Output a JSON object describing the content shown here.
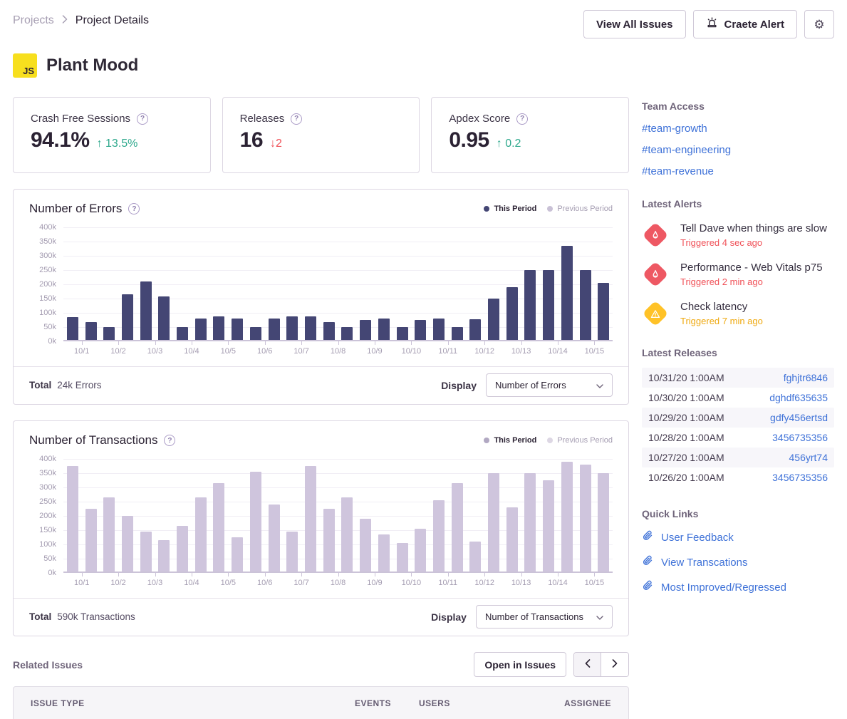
{
  "breadcrumb": {
    "items": [
      "Projects",
      "Project Details"
    ]
  },
  "header": {
    "view_all_issues": "View All Issues",
    "create_alert": "Craete Alert"
  },
  "project": {
    "badge": "JS",
    "name": "Plant Mood"
  },
  "icons": {
    "help": "?",
    "settings": "⚙"
  },
  "colors": {
    "accent_blue": "#3f72d8",
    "positive_green": "#2fa98d",
    "negative_red": "#f05158",
    "critical_icon_red": "#ee5863",
    "warning_icon_yellow": "#ffc227",
    "warning_text_yellow": "#efa910",
    "bar_dark": "#444674",
    "bar_light": "#cfc5dd"
  },
  "stats": [
    {
      "label": "Crash Free Sessions",
      "value": "94.1%",
      "delta_arrow": "↑",
      "delta": "13.5%",
      "delta_color": "#2fa98d"
    },
    {
      "label": "Releases",
      "value": "16",
      "delta_arrow": "↓",
      "delta": "2",
      "delta_color": "#f05158"
    },
    {
      "label": "Apdex Score",
      "value": "0.95",
      "delta_arrow": "↑",
      "delta": "0.2",
      "delta_color": "#2fa98d"
    }
  ],
  "chart_data": [
    {
      "type": "bar",
      "title": "Number of Errors",
      "legend": [
        {
          "label": "This Period",
          "dot_color": "#444674"
        },
        {
          "label": "Previous Period",
          "dot_color": "#c9c1d6"
        }
      ],
      "bar_color": "#444674",
      "categories": [
        "10/1",
        "10/2",
        "10/3",
        "10/4",
        "10/5",
        "10/6",
        "10/7",
        "10/8",
        "10/9",
        "10/10",
        "10/11",
        "10/12",
        "10/13",
        "10/14",
        "10/15"
      ],
      "values_thousands": [
        [
          80,
          62
        ],
        [
          45,
          160
        ],
        [
          205,
          152
        ],
        [
          45,
          75
        ],
        [
          82,
          75
        ],
        [
          45,
          75
        ],
        [
          82,
          82
        ],
        [
          62,
          45
        ],
        [
          70,
          75
        ],
        [
          45,
          70
        ],
        [
          75,
          45
        ],
        [
          72,
          145
        ],
        [
          185,
          245
        ],
        [
          245,
          330
        ],
        [
          245,
          200
        ]
      ],
      "y_ticks": [
        "400k",
        "350k",
        "300k",
        "250k",
        "200k",
        "150k",
        "100k",
        "50k",
        "0k"
      ],
      "ylim_thousands": [
        0,
        400
      ],
      "ylabel": "",
      "xlabel": "",
      "grid": true,
      "legend_position": "top-right",
      "footer": {
        "total_label": "Total",
        "total_value": "24k Errors",
        "display_label": "Display",
        "display_value": "Number of Errors"
      }
    },
    {
      "type": "bar",
      "title": "Number of Transactions",
      "legend": [
        {
          "label": "This Period",
          "dot_color": "#b1a8c2"
        },
        {
          "label": "Previous Period",
          "dot_color": "#ddd7e4"
        }
      ],
      "bar_color": "#cfc5dd",
      "categories": [
        "10/1",
        "10/2",
        "10/3",
        "10/4",
        "10/5",
        "10/6",
        "10/7",
        "10/8",
        "10/9",
        "10/10",
        "10/11",
        "10/12",
        "10/13",
        "10/14",
        "10/15"
      ],
      "values_thousands": [
        [
          370,
          220
        ],
        [
          260,
          195
        ],
        [
          140,
          110
        ],
        [
          160,
          260
        ],
        [
          310,
          120
        ],
        [
          350,
          235
        ],
        [
          140,
          370
        ],
        [
          220,
          260
        ],
        [
          185,
          130
        ],
        [
          100,
          150
        ],
        [
          250,
          310
        ],
        [
          105,
          345
        ],
        [
          225,
          345
        ],
        [
          320,
          385
        ],
        [
          375,
          345
        ]
      ],
      "y_ticks": [
        "400k",
        "350k",
        "300k",
        "250k",
        "200k",
        "150k",
        "100k",
        "50k",
        "0k"
      ],
      "ylim_thousands": [
        0,
        400
      ],
      "ylabel": "",
      "xlabel": "",
      "grid": true,
      "legend_position": "top-right",
      "footer": {
        "total_label": "Total",
        "total_value": "590k Transactions",
        "display_label": "Display",
        "display_value": "Number of Transactions"
      }
    }
  ],
  "related_issues": {
    "title": "Related Issues",
    "open_button": "Open in Issues",
    "columns": [
      "ISSUE TYPE",
      "EVENTS",
      "USERS",
      "ASSIGNEE"
    ]
  },
  "sidebar": {
    "team_access": {
      "title": "Team Access",
      "links": [
        "#team-growth",
        "#team-engineering",
        "#team-revenue"
      ]
    },
    "latest_alerts": {
      "title": "Latest Alerts",
      "alerts": [
        {
          "title": "Tell Dave when things are slow",
          "status": "Triggered 4 sec ago",
          "severity": "critical"
        },
        {
          "title": "Performance - Web Vitals p75",
          "status": "Triggered 2 min ago",
          "severity": "critical"
        },
        {
          "title": "Check latency",
          "status": "Triggered 7 min ago",
          "severity": "warning"
        }
      ]
    },
    "latest_releases": {
      "title": "Latest Releases",
      "rows": [
        {
          "date": "10/31/20 1:00AM",
          "version": "fghjtr6846"
        },
        {
          "date": "10/30/20 1:00AM",
          "version": "dghdf635635"
        },
        {
          "date": "10/29/20 1:00AM",
          "version": "gdfy456ertsd"
        },
        {
          "date": "10/28/20 1:00AM",
          "version": "3456735356"
        },
        {
          "date": "10/27/20 1:00AM",
          "version": "456yrt74"
        },
        {
          "date": "10/26/20 1:00AM",
          "version": "3456735356"
        }
      ]
    },
    "quick_links": {
      "title": "Quick Links",
      "links": [
        "User Feedback",
        "View Transcations",
        "Most Improved/Regressed"
      ]
    }
  }
}
